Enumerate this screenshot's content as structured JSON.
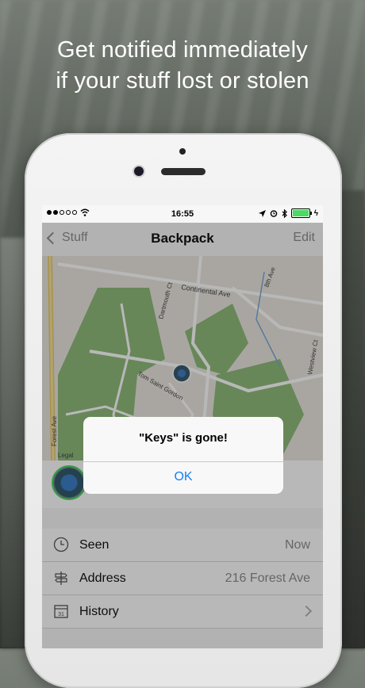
{
  "headline": {
    "line1": "Get notified immediately",
    "line2": "if your stuff lost or stolen"
  },
  "status_bar": {
    "time": "16:55",
    "signal": "●●○○○",
    "icons": [
      "wifi-icon",
      "location-arrow-icon",
      "alarm-icon",
      "bluetooth-icon",
      "battery-icon"
    ],
    "battery_color": "#4cd964"
  },
  "nav": {
    "back_label": "Stuff",
    "title": "Backpack",
    "edit_label": "Edit"
  },
  "map": {
    "labels": [
      "Continental Ave",
      "Dartmouth Ct",
      "8th Ave",
      "Westview Ct",
      "Forest Ave",
      "Tom Saint Gordon",
      "Legal"
    ]
  },
  "list": {
    "rows": [
      {
        "icon": "clock-icon",
        "label": "Seen",
        "value": "Now"
      },
      {
        "icon": "signpost-icon",
        "label": "Address",
        "value": "216 Forest Ave"
      },
      {
        "icon": "calendar-icon",
        "label": "History",
        "value": "",
        "calendar_day": "31"
      }
    ]
  },
  "alert": {
    "title": "\"Keys\" is gone!",
    "ok_label": "OK"
  },
  "colors": {
    "accent": "#147efb",
    "green": "#4cd964",
    "gray_text": "#8e8e93"
  }
}
